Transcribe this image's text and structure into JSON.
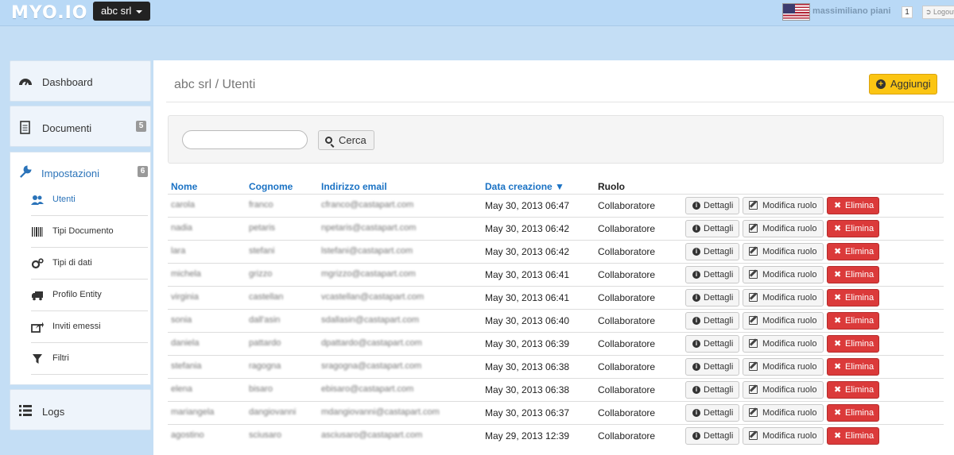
{
  "topbar": {
    "logo": "MYO.IO",
    "company": "abc srl",
    "username": "massimiliano piani",
    "notifications": "1",
    "logout": "Logout"
  },
  "sidebar": {
    "dashboard": "Dashboard",
    "documenti": "Documenti",
    "documenti_badge": "5",
    "impostazioni": "Impostazioni",
    "impostazioni_badge": "6",
    "sub": [
      "Utenti",
      "Tipi Documento",
      "Tipi di dati",
      "Profilo Entity",
      "Inviti emessi",
      "Filtri"
    ],
    "logs": "Logs"
  },
  "main": {
    "breadcrumb": "abc srl / Utenti",
    "add_label": "Aggiungi",
    "search_placeholder": "",
    "search_button": "Cerca",
    "columns": [
      "Nome",
      "Cognome",
      "Indirizzo email",
      "Data creazione ▼",
      "Ruolo"
    ],
    "rows": [
      {
        "nome": "carola",
        "cognome": "franco",
        "email": "cfranco@castapart.com",
        "data": "May 30, 2013 06:47",
        "ruolo": "Collaboratore"
      },
      {
        "nome": "nadia",
        "cognome": "petaris",
        "email": "npetaris@castapart.com",
        "data": "May 30, 2013 06:42",
        "ruolo": "Collaboratore"
      },
      {
        "nome": "lara",
        "cognome": "stefani",
        "email": "lstefani@castapart.com",
        "data": "May 30, 2013 06:42",
        "ruolo": "Collaboratore"
      },
      {
        "nome": "michela",
        "cognome": "grizzo",
        "email": "mgrizzo@castapart.com",
        "data": "May 30, 2013 06:41",
        "ruolo": "Collaboratore"
      },
      {
        "nome": "virginia",
        "cognome": "castellan",
        "email": "vcastellan@castapart.com",
        "data": "May 30, 2013 06:41",
        "ruolo": "Collaboratore"
      },
      {
        "nome": "sonia",
        "cognome": "dall'asin",
        "email": "sdallasin@castapart.com",
        "data": "May 30, 2013 06:40",
        "ruolo": "Collaboratore"
      },
      {
        "nome": "daniela",
        "cognome": "pattardo",
        "email": "dpattardo@castapart.com",
        "data": "May 30, 2013 06:39",
        "ruolo": "Collaboratore"
      },
      {
        "nome": "stefania",
        "cognome": "ragogna",
        "email": "sragogna@castapart.com",
        "data": "May 30, 2013 06:38",
        "ruolo": "Collaboratore"
      },
      {
        "nome": "elena",
        "cognome": "bisaro",
        "email": "ebisaro@castapart.com",
        "data": "May 30, 2013 06:38",
        "ruolo": "Collaboratore"
      },
      {
        "nome": "mariangela",
        "cognome": "dangiovanni",
        "email": "mdangiovanni@castapart.com",
        "data": "May 30, 2013 06:37",
        "ruolo": "Collaboratore"
      },
      {
        "nome": "agostino",
        "cognome": "sciusaro",
        "email": "asciusaro@castapart.com",
        "data": "May 29, 2013 12:39",
        "ruolo": "Collaboratore"
      }
    ],
    "btn_dettagli": "Dettagli",
    "btn_modifica": "Modifica ruolo",
    "btn_elimina": "Elimina"
  }
}
